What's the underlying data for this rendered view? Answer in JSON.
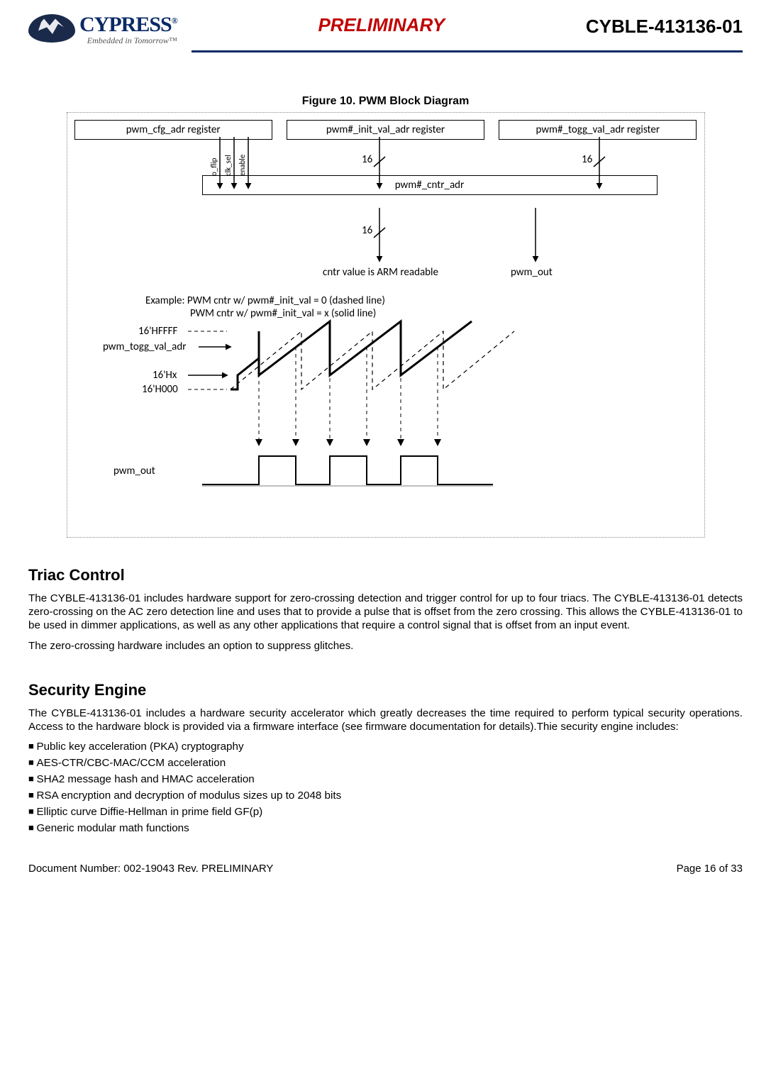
{
  "header": {
    "logo_text": "CYPRESS",
    "logo_reg": "®",
    "logo_sub": "Embedded in Tomorrow™",
    "center": "PRELIMINARY",
    "part": "CYBLE-413136-01"
  },
  "figure": {
    "caption": "Figure 10.  PWM Block Diagram",
    "regs": {
      "cfg": "pwm_cfg_adr register",
      "init": "pwm#_init_val_adr register",
      "togg": "pwm#_togg_val_adr register"
    },
    "cfg_sig": {
      "o_flip": "o_flip",
      "clk_sel": "clk_sel",
      "enable": "enable"
    },
    "bus16_a": "16",
    "bus16_b": "16",
    "bus16_c": "16",
    "cntr": "pwm#_cntr_adr",
    "readable": "cntr value is ARM readable",
    "pwm_out_sig": "pwm_out",
    "example_l1": "Example: PWM cntr w/ pwm#_init_val = 0 (dashed line)",
    "example_l2": "PWM cntr w/ pwm#_init_val = x (solid line)",
    "y": {
      "ffff": "16'HFFFF",
      "togg": "pwm_togg_val_adr",
      "hx": "16'Hx",
      "h000": "16'H000"
    },
    "pwm_out_label": "pwm_out"
  },
  "triac": {
    "title": "Triac Control",
    "p1": "The CYBLE-413136-01 includes hardware support for zero-crossing detection and trigger control for up to four triacs. The CYBLE-413136-01 detects zero-crossing on the AC zero detection line and uses that to provide a pulse that is offset from the zero crossing. This allows the CYBLE-413136-01 to be used in dimmer applications, as well as any other applications that require a con­trol signal that is offset from an input event.",
    "p2": "The zero-crossing hardware includes an option to suppress glitches."
  },
  "sec": {
    "title": "Security Engine",
    "p1": "The CYBLE-413136-01 includes a hardware security accelerator which greatly decreases the time required to perform typical secu­rity operations. Access to the hardware block is provided via a firmware interface (see firmware documentation for details).Thie security engine includes:",
    "items": [
      "Public key acceleration (PKA) cryptography",
      "AES-CTR/CBC-MAC/CCM acceleration",
      "SHA2 message hash and HMAC acceleration",
      "RSA encryption and decryption of modulus sizes up to 2048 bits",
      "Elliptic curve Diffie-Hellman in prime field GF(p)",
      "Generic modular math functions"
    ]
  },
  "footer": {
    "left": "Document Number:  002-19043 Rev. PRELIMINARY",
    "right": "Page 16 of 33"
  }
}
